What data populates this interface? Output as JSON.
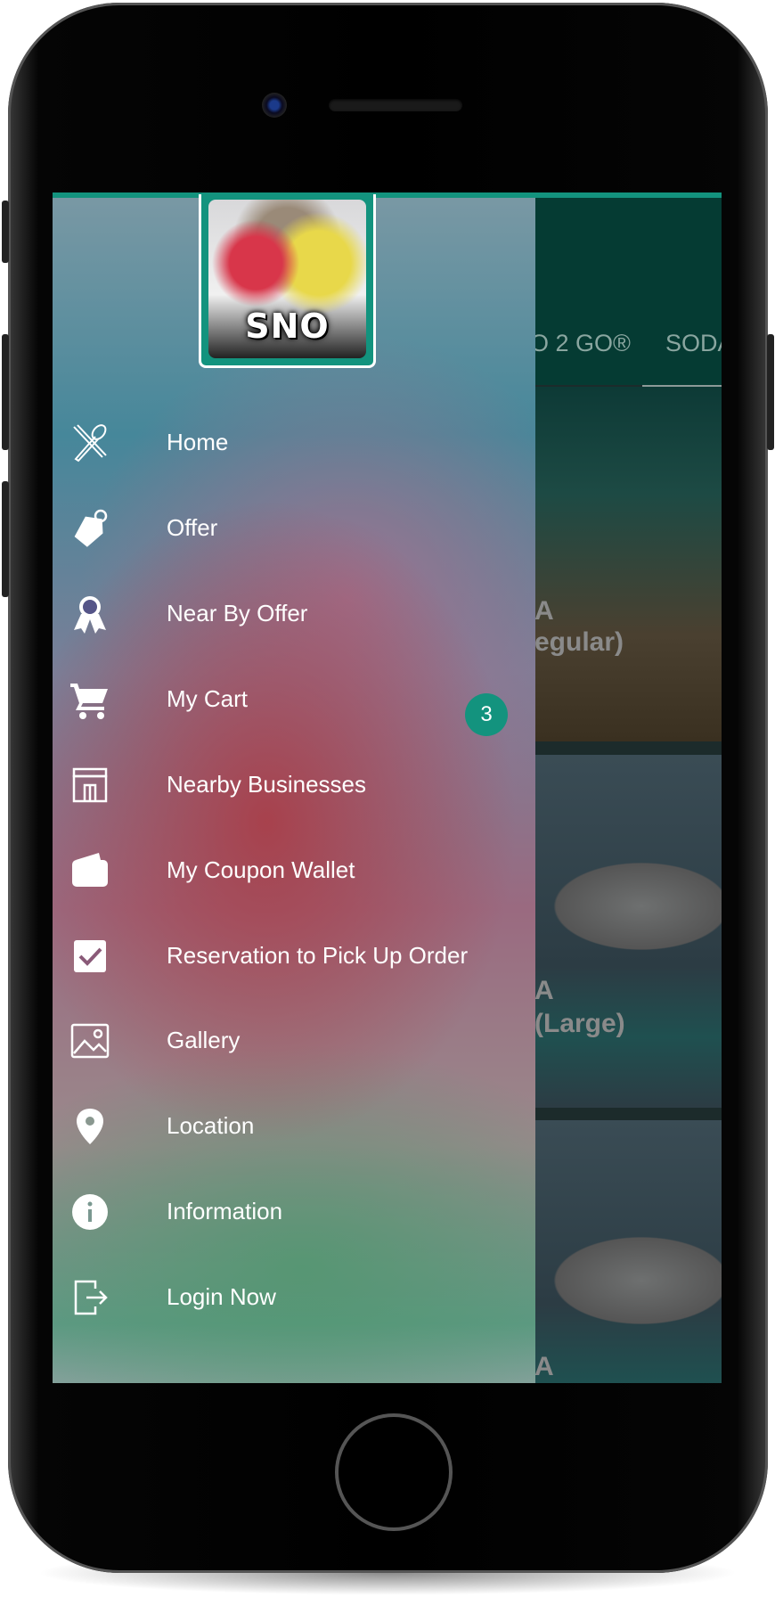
{
  "colors": {
    "accent": "#13937e",
    "header": "#053b33",
    "badge": "#13937e"
  },
  "logo": {
    "text": "SNO"
  },
  "tabs": [
    {
      "label": "O 2 GO®"
    },
    {
      "label": "SODA"
    }
  ],
  "cards": [
    {
      "label1": "A",
      "label2": "egular)"
    },
    {
      "label1": "A",
      "label2": "(Large)"
    },
    {
      "label1": "A",
      "label2": ""
    }
  ],
  "menu": [
    {
      "label": "Home",
      "icon": "fork-spoon-icon"
    },
    {
      "label": "Offer",
      "icon": "tag-icon",
      "badge": "3"
    },
    {
      "label": "Near By Offer",
      "icon": "award-ribbon-icon"
    },
    {
      "label": "My Cart",
      "icon": "cart-icon"
    },
    {
      "label": "Nearby Businesses",
      "icon": "storefront-icon"
    },
    {
      "label": "My Coupon Wallet",
      "icon": "wallet-icon"
    },
    {
      "label": "Reservation to Pick Up Order",
      "icon": "checkbox-icon"
    },
    {
      "label": "Gallery",
      "icon": "image-icon"
    },
    {
      "label": "Location",
      "icon": "location-pin-icon"
    },
    {
      "label": "Information",
      "icon": "info-icon"
    },
    {
      "label": "Login Now",
      "icon": "login-icon"
    }
  ]
}
